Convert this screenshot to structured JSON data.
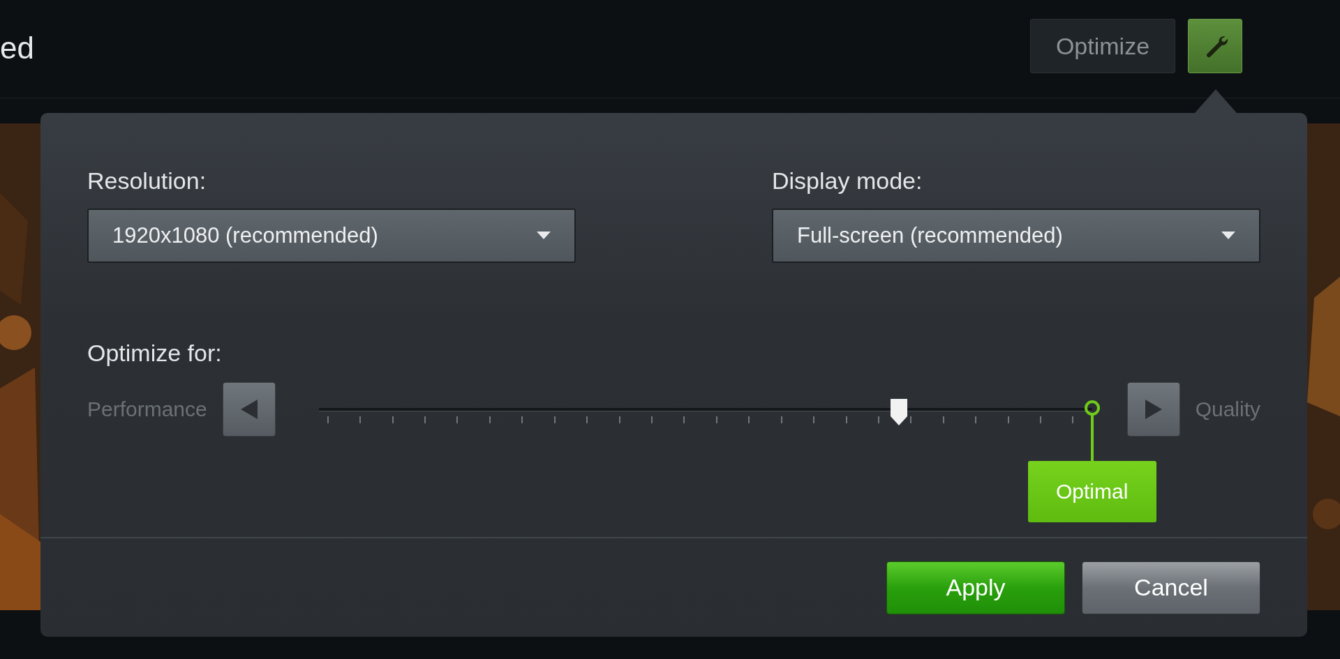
{
  "header": {
    "title": "ed",
    "optimize_button": "Optimize"
  },
  "popup": {
    "fields": [
      {
        "label": "Resolution:",
        "value": "1920x1080 (recommended)"
      },
      {
        "label": "Display mode:",
        "value": "Full-screen (recommended)"
      }
    ],
    "optimize_for": {
      "label": "Optimize for:",
      "left_label": "Performance",
      "right_label": "Quality",
      "level": 0.75,
      "optimal_tag": "Optimal"
    },
    "buttons": [
      {
        "label": "Apply",
        "kind": "primary"
      },
      {
        "label": "Cancel",
        "kind": "secondary"
      }
    ]
  }
}
